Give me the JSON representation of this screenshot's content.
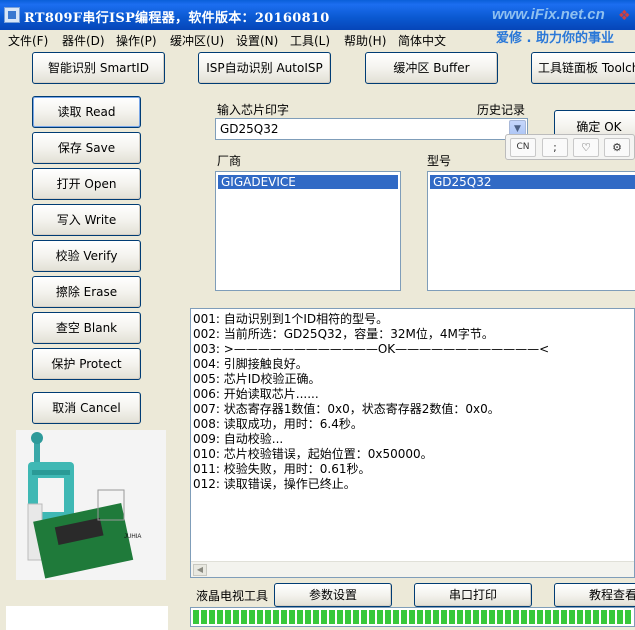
{
  "window": {
    "title": "RT809F串行ISP编程器，软件版本：20160810",
    "watermark": "www.iFix.net.cn",
    "slogan": "爱修 . 助力你的事业"
  },
  "menu": [
    "文件(F)",
    "器件(D)",
    "操作(P)",
    "缓冲区(U)",
    "设置(N)",
    "工具(L)",
    "帮助(H)",
    "简体中文"
  ],
  "top_buttons": {
    "smartid": "智能识别 SmartID",
    "autoisp": "ISP自动识别 AutoISP",
    "buffer": "缓冲区 Buffer",
    "toolchain": "工具链面板 Toolchain"
  },
  "side_buttons": {
    "read": "读取 Read",
    "save": "保存 Save",
    "open": "打开 Open",
    "write": "写入 Write",
    "verify": "校验 Verify",
    "erase": "擦除 Erase",
    "blank": "查空 Blank",
    "protect": "保护 Protect",
    "cancel": "取消 Cancel"
  },
  "chip_input": {
    "label": "输入芯片印字",
    "history_label": "历史记录",
    "value": "GD25Q32",
    "ok_button": "确定 OK"
  },
  "vendor": {
    "label": "厂商",
    "selected": "GIGADEVICE"
  },
  "model": {
    "label": "型号",
    "selected": "GD25Q32"
  },
  "float_toolbar": {
    "lang": "CN"
  },
  "log": [
    "001: 自动识别到1个ID相符的型号。",
    "002: 当前所选：GD25Q32，容量：32M位，4M字节。",
    "003: >————————————OK————————————<",
    "004: 引脚接触良好。",
    "005: 芯片ID校验正确。",
    "006: 开始读取芯片......",
    "007: 状态寄存器1数值：0x0，状态寄存器2数值：0x0。",
    "008: 读取成功，用时：6.4秒。",
    "009: 自动校验...",
    "010: 芯片校验错误，起始位置：0x50000。",
    "011: 校验失败，用时：0.61秒。",
    "012: 读取错误，操作已终止。"
  ],
  "bottom": {
    "lcd_label": "液晶电视工具",
    "params": "参数设置",
    "serial_print": "串口打印",
    "tutorial": "教程查看"
  },
  "progress": {
    "value": 1.0,
    "color": "#37c83a"
  },
  "colors": {
    "titlebar": "#0a58d0",
    "selection": "#316ac5",
    "face": "#ece9d8"
  }
}
